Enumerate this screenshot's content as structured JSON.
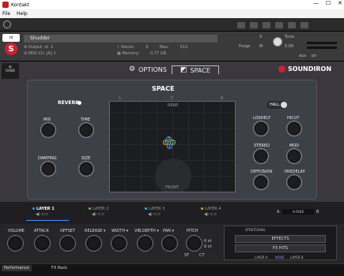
{
  "window": {
    "title": "Kontakt",
    "min": "—",
    "max": "☐",
    "close": "✕"
  },
  "menu": [
    "File",
    "Help"
  ],
  "header": {
    "brand_logo": "ni",
    "instrument_name": "Shudder",
    "output_label": "⊕ Output: st. 1",
    "midi_label": "⊟ MIDI Ch: [A] 1",
    "voices_label": "♪ Voices:",
    "voices_value": "0",
    "max_label": "Max:",
    "max_value": "512",
    "memory_label": "▣ Memory:",
    "memory_value": "0.77 GB",
    "purge_label": "Purge",
    "tune_label": "Tune",
    "tune_value": "0.00",
    "solo": "S",
    "mute": "M",
    "aux": "aux",
    "pv": "pv"
  },
  "topnav": {
    "rand": "RAND",
    "tabs": [
      {
        "label": "OPTIONS",
        "icon": "⚙",
        "active": false
      },
      {
        "label": "SPACE",
        "icon": "◩",
        "active": true
      }
    ],
    "brand": "SOUNDIRON"
  },
  "space": {
    "title": "SPACE",
    "reverb_label": "REVERB",
    "hall_label": "HALL",
    "left_knobs": [
      {
        "label": "MIX"
      },
      {
        "label": "TIME"
      },
      {
        "label": "DAMPING"
      },
      {
        "label": "SIZE"
      }
    ],
    "right_knobs": [
      {
        "label": "LOSHELF"
      },
      {
        "label": "HICUT"
      },
      {
        "label": "STEREO"
      },
      {
        "label": "MOD"
      },
      {
        "label": "DIFFUSION"
      },
      {
        "label": "PREDELAY"
      }
    ],
    "room": {
      "l": "L",
      "c": "C",
      "r": "R",
      "rear": "REAR",
      "front": "FRONT",
      "sources": [
        "1",
        "2",
        "3",
        "4"
      ]
    }
  },
  "layers": [
    {
      "label": "LAYER 1",
      "active": true,
      "color": "#4a8cff"
    },
    {
      "label": "LAYER 2",
      "active": false,
      "color": "#5cc85c"
    },
    {
      "label": "LAYER 3",
      "active": false,
      "color": "#4ab0d8"
    },
    {
      "label": "LAYER 4",
      "active": false,
      "color": "#e0a030"
    }
  ],
  "layer_icons": "◀) ⊂⊃",
  "xfade": {
    "a": "A",
    "b": "B",
    "label": "X-FADE"
  },
  "bottom": {
    "knobs": [
      "VOLUME",
      "ATTACK",
      "OFFSET",
      "RELEASE ▾",
      "WIDTH ▾",
      "VIB.DEPTH ▾",
      "PAN ▾",
      "PITCH"
    ],
    "pitch_vals": [
      "0 st",
      "0 ct"
    ],
    "st_label": "ST",
    "ct_label": "CT"
  },
  "fx": {
    "stretching": "STRETCHING",
    "effects": "EFFECTS",
    "fx_hits": "FX HITS",
    "layer_a": "LAYER A",
    "none": "NONE",
    "layer_b": "LAYER B"
  },
  "status": {
    "tabs": [
      "Performance",
      "FX Rack"
    ]
  }
}
